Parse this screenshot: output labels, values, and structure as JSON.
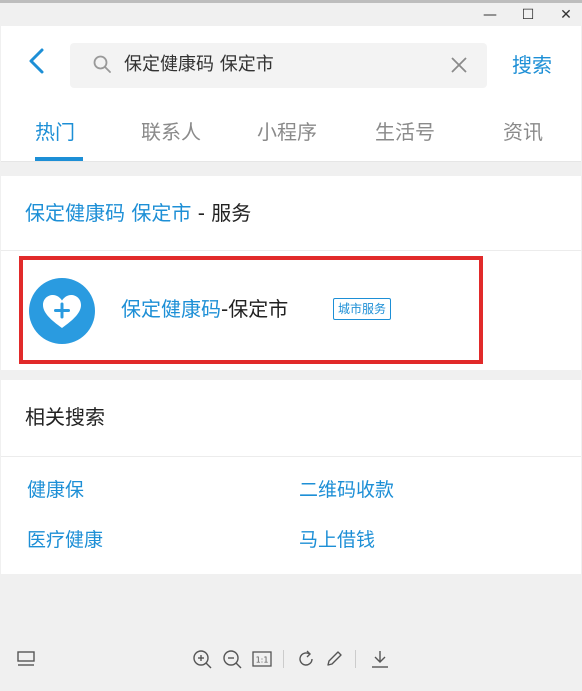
{
  "window_controls": {
    "minimize": "—",
    "maximize": "☐",
    "close": "✕"
  },
  "header": {
    "back_icon": "chevron-left-icon",
    "search_query": "保定健康码 保定市",
    "search_button": "搜索"
  },
  "tabs": [
    {
      "label": "热门",
      "active": true
    },
    {
      "label": "联系人",
      "active": false
    },
    {
      "label": "小程序",
      "active": false
    },
    {
      "label": "生活号",
      "active": false
    },
    {
      "label": "资讯",
      "active": false
    }
  ],
  "service_section": {
    "title_highlight": "保定健康码 保定市",
    "title_suffix": " - 服务"
  },
  "result": {
    "icon": "heart-plus-icon",
    "name_highlight": "保定健康码",
    "name_suffix": "-保定市",
    "badge": "城市服务"
  },
  "related": {
    "title": "相关搜索",
    "items": [
      "健康保",
      "二维码收款",
      "医疗健康",
      "马上借钱"
    ]
  },
  "toolbar": {
    "icons": [
      "layout-icon",
      "zoom-in-icon",
      "zoom-out-icon",
      "actual-size-icon",
      "rotate-icon",
      "edit-icon",
      "download-icon"
    ],
    "actual_size_label": "1:1"
  },
  "colors": {
    "accent": "#1d8fd6",
    "highlight_border": "#e12a2a",
    "icon_bg": "#2a9be0"
  }
}
